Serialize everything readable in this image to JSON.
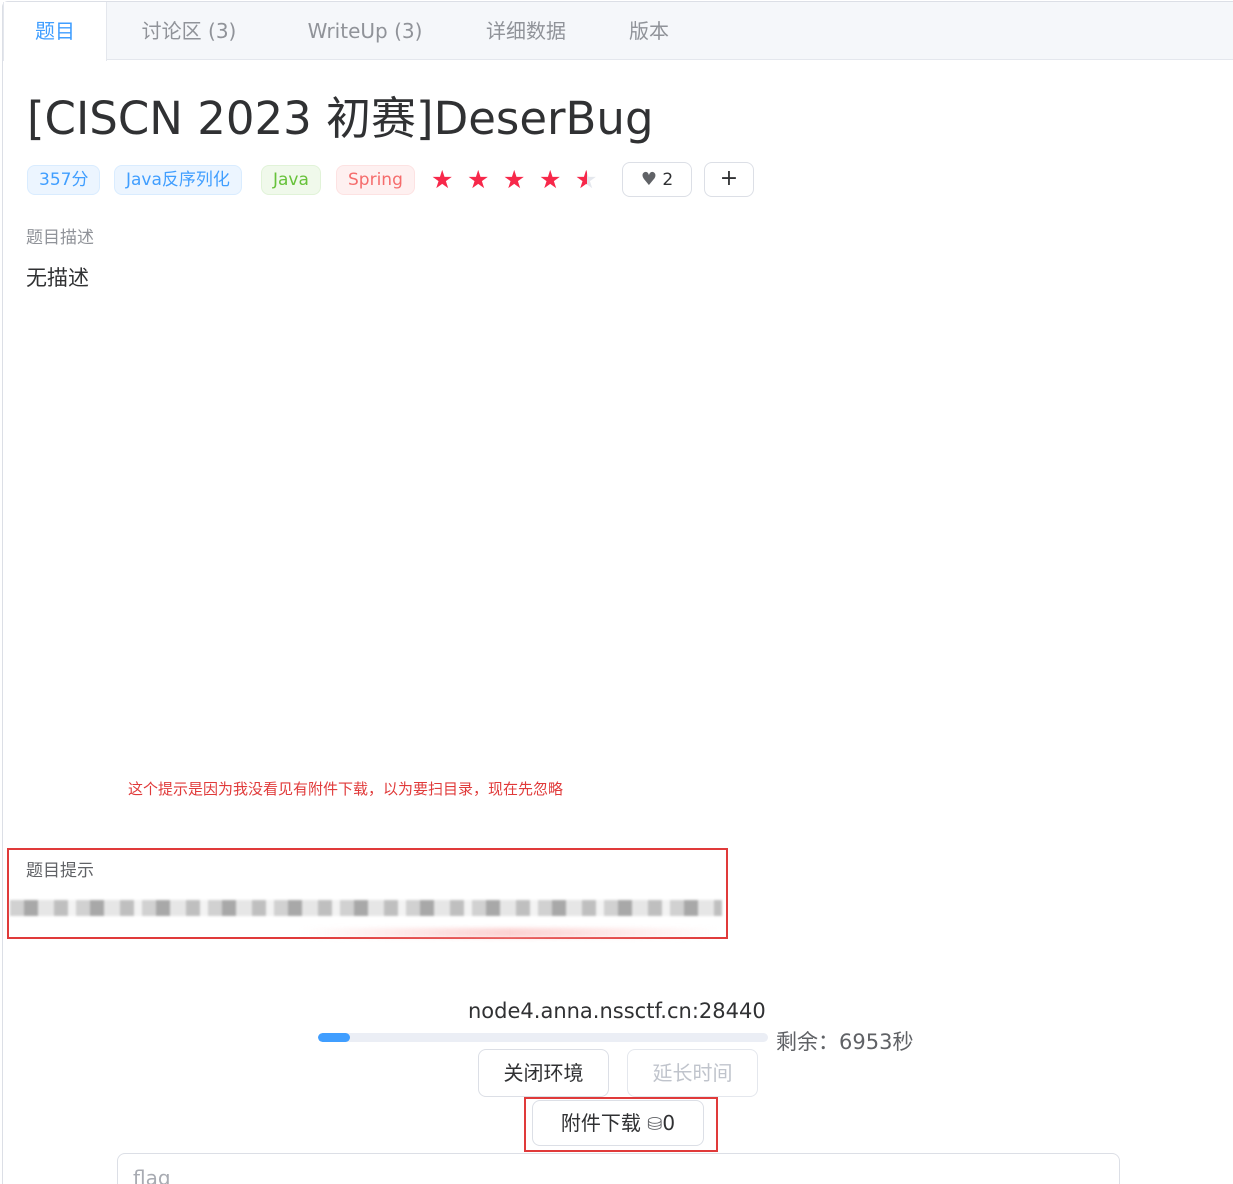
{
  "tabs": [
    {
      "label": "题目",
      "active": true
    },
    {
      "label": "讨论区 (3)",
      "active": false
    },
    {
      "label": "WriteUp (3)",
      "active": false
    },
    {
      "label": "详细数据",
      "active": false
    },
    {
      "label": "版本",
      "active": false
    }
  ],
  "challenge": {
    "title": "[CISCN 2023 初赛]DeserBug",
    "score": "357分",
    "tags": [
      "Java反序列化",
      "Java",
      "Spring"
    ],
    "rating": 4.5,
    "rating_max": 5,
    "likes": "2",
    "add_label": "+"
  },
  "description": {
    "label": "题目描述",
    "text": "无描述"
  },
  "annotation": {
    "note": "这个提示是因为我没看见有附件下载，以为要扫目录，现在先忽略"
  },
  "hint": {
    "label": "题目提示"
  },
  "environment": {
    "host": "node4.anna.nssctf.cn:28440",
    "progress_fraction": 0.07,
    "remaining": "剩余：6953秒",
    "close_label": "关闭环境",
    "extend_label": "延长时间"
  },
  "attachment": {
    "label": "附件下载",
    "coin_icon": "⛁",
    "cost": "0"
  },
  "flag": {
    "placeholder": "flag"
  },
  "colors": {
    "primary": "#409eff",
    "star": "#f7284a",
    "annotation_red": "#e03a3a"
  }
}
